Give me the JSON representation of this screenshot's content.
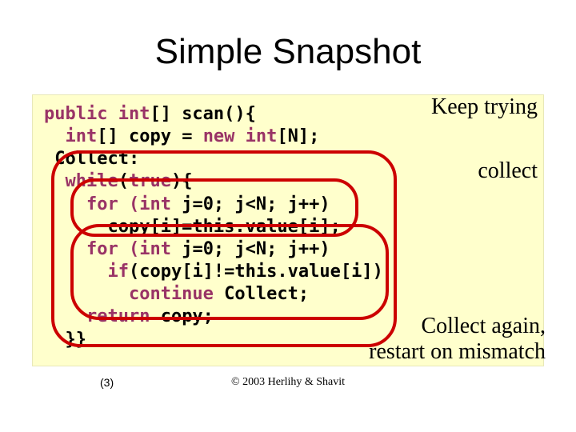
{
  "title": "Simple Snapshot",
  "code": {
    "l1a": "public int",
    "l1b": "[] scan(){",
    "l2a": "  int",
    "l2b": "[] copy = ",
    "l2c": "new int",
    "l2d": "[N];",
    "l3": " Collect:",
    "l4a": "  while",
    "l4b": "(",
    "l4c": "true",
    "l4d": "){",
    "l5a": "    for (int",
    "l5b": " j=0; j<N; j++)",
    "l6": "      copy[i]=this.value[i];",
    "l7a": "    for (int",
    "l7b": " j=0; j<N; j++)",
    "l8a": "      if",
    "l8b": "(copy[i]!=this.value[i])",
    "l9a": "        continue",
    "l9b": " Collect;",
    "l10a": "    return",
    "l10b": " copy;",
    "l11": "  }}"
  },
  "annotations": {
    "keep_trying": "Keep trying",
    "collect": "collect",
    "restart_l1": "Collect again,",
    "restart_l2": "restart on mismatch"
  },
  "footer": {
    "page": "(3)",
    "copyright": "© 2003 Herlihy & Shavit"
  }
}
